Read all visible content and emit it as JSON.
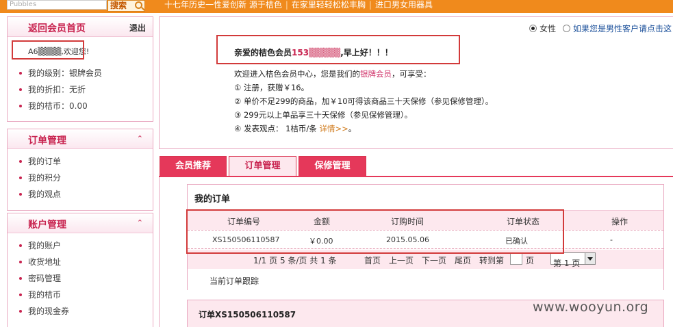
{
  "topbar": {
    "search_placeholder": "Pubbles",
    "search_button": "搜索",
    "links": [
      "十七年历史一性爱创新 源于桔色",
      "在家里轻轻松松丰胸",
      "进口男女用器具"
    ]
  },
  "sidebar": {
    "home": {
      "title": "返回会员首页",
      "logout": "退出"
    },
    "user": {
      "account_masked": "A6▒▒▒▒,",
      "welcome": "欢迎您!"
    },
    "info": [
      "我的级别：银牌会员",
      "我的折扣：无折",
      "我的桔币：0.00"
    ],
    "orders": {
      "title": "订单管理",
      "items": [
        "我的订单",
        "我的积分",
        "我的观点"
      ]
    },
    "account": {
      "title": "账户管理",
      "items": [
        "我的账户",
        "收货地址",
        "密码管理",
        "我的桔币",
        "我的现金券"
      ]
    }
  },
  "main": {
    "gender": {
      "female": "女性",
      "male": "如果您是男性客户请点击这"
    },
    "greeting": {
      "prefix": "亲爱的桔色会员",
      "account": "153▒▒▒▒▒",
      "suffix": ",早上好！！！"
    },
    "intro": {
      "line1_prefix": "欢迎进入桔色会员中心，您是我们的",
      "level": "银牌会员",
      "line1_suffix": "，可享受：",
      "benefit1": "① 注册，获赠￥16。",
      "benefit2": "② 单价不足299的商品，加￥10可得该商品三十天保修（参见保修管理）。",
      "benefit3": "③ 299元以上单品享三十天保修（参见保修管理）。",
      "benefit4_prefix": "④ 发表观点： 1桔币/条 ",
      "benefit4_link": "详情>>",
      "benefit4_suffix": "。"
    },
    "tabs": [
      "会员推荐",
      "订单管理",
      "保修管理"
    ]
  },
  "orders": {
    "title": "我的订单",
    "columns": [
      "订单编号",
      "金额",
      "订购时间",
      "订单状态",
      "操作"
    ],
    "rows": [
      {
        "id": "XS150506110587",
        "amount": "￥0.00",
        "date": "2015.05.06",
        "status": "已确认",
        "action": "-"
      }
    ],
    "pager": {
      "summary": "1/1 页 5 条/页  共 1 条",
      "first": "首页",
      "prev": "上一页",
      "next": "下一页",
      "last": "尾页",
      "goto": "转到第",
      "page_unit": "页",
      "select_value": "第 1 页"
    },
    "tracking_label": "当前订单跟踪",
    "detail_title": "订单XS150506110587"
  },
  "watermark": "www.wooyun.org",
  "colors": {
    "accent": "#f08a1c",
    "pink": "#c8234f",
    "tab": "#e5385a"
  }
}
